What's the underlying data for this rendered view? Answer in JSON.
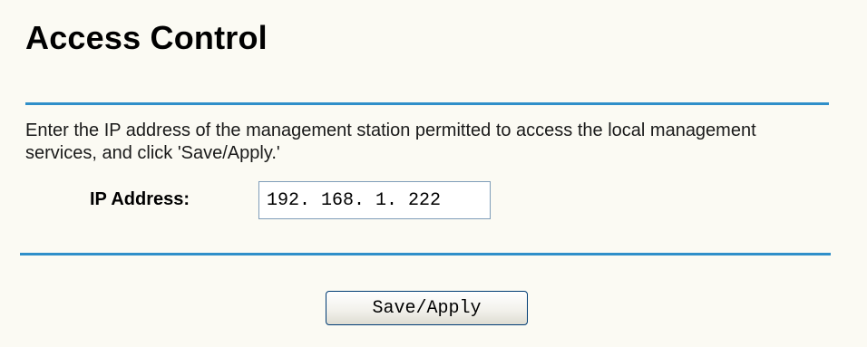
{
  "page": {
    "title": "Access Control",
    "description": "Enter the IP address of the management station permitted to access the local management services, and click 'Save/Apply.'"
  },
  "form": {
    "ip_label": "IP Address:",
    "ip_value": "192. 168. 1. 222"
  },
  "actions": {
    "save_apply_label": "Save/Apply"
  },
  "colors": {
    "background": "#fbfaf3",
    "divider": "#2f8fc9"
  }
}
